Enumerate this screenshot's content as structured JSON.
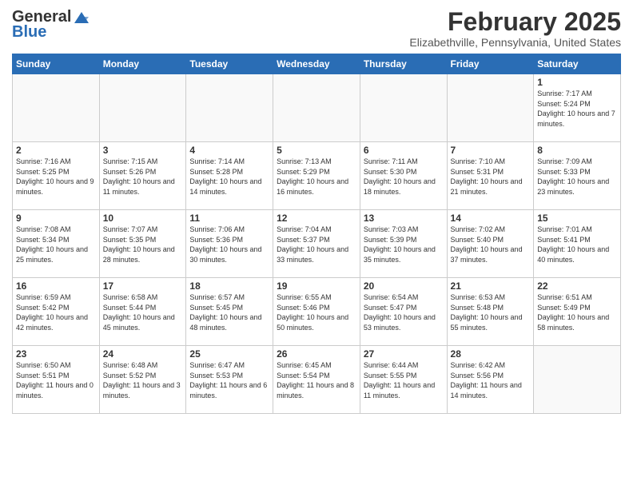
{
  "header": {
    "logo_general": "General",
    "logo_blue": "Blue",
    "month_title": "February 2025",
    "location": "Elizabethville, Pennsylvania, United States"
  },
  "weekdays": [
    "Sunday",
    "Monday",
    "Tuesday",
    "Wednesday",
    "Thursday",
    "Friday",
    "Saturday"
  ],
  "weeks": [
    [
      {
        "day": "",
        "info": ""
      },
      {
        "day": "",
        "info": ""
      },
      {
        "day": "",
        "info": ""
      },
      {
        "day": "",
        "info": ""
      },
      {
        "day": "",
        "info": ""
      },
      {
        "day": "",
        "info": ""
      },
      {
        "day": "1",
        "info": "Sunrise: 7:17 AM\nSunset: 5:24 PM\nDaylight: 10 hours and 7 minutes."
      }
    ],
    [
      {
        "day": "2",
        "info": "Sunrise: 7:16 AM\nSunset: 5:25 PM\nDaylight: 10 hours and 9 minutes."
      },
      {
        "day": "3",
        "info": "Sunrise: 7:15 AM\nSunset: 5:26 PM\nDaylight: 10 hours and 11 minutes."
      },
      {
        "day": "4",
        "info": "Sunrise: 7:14 AM\nSunset: 5:28 PM\nDaylight: 10 hours and 14 minutes."
      },
      {
        "day": "5",
        "info": "Sunrise: 7:13 AM\nSunset: 5:29 PM\nDaylight: 10 hours and 16 minutes."
      },
      {
        "day": "6",
        "info": "Sunrise: 7:11 AM\nSunset: 5:30 PM\nDaylight: 10 hours and 18 minutes."
      },
      {
        "day": "7",
        "info": "Sunrise: 7:10 AM\nSunset: 5:31 PM\nDaylight: 10 hours and 21 minutes."
      },
      {
        "day": "8",
        "info": "Sunrise: 7:09 AM\nSunset: 5:33 PM\nDaylight: 10 hours and 23 minutes."
      }
    ],
    [
      {
        "day": "9",
        "info": "Sunrise: 7:08 AM\nSunset: 5:34 PM\nDaylight: 10 hours and 25 minutes."
      },
      {
        "day": "10",
        "info": "Sunrise: 7:07 AM\nSunset: 5:35 PM\nDaylight: 10 hours and 28 minutes."
      },
      {
        "day": "11",
        "info": "Sunrise: 7:06 AM\nSunset: 5:36 PM\nDaylight: 10 hours and 30 minutes."
      },
      {
        "day": "12",
        "info": "Sunrise: 7:04 AM\nSunset: 5:37 PM\nDaylight: 10 hours and 33 minutes."
      },
      {
        "day": "13",
        "info": "Sunrise: 7:03 AM\nSunset: 5:39 PM\nDaylight: 10 hours and 35 minutes."
      },
      {
        "day": "14",
        "info": "Sunrise: 7:02 AM\nSunset: 5:40 PM\nDaylight: 10 hours and 37 minutes."
      },
      {
        "day": "15",
        "info": "Sunrise: 7:01 AM\nSunset: 5:41 PM\nDaylight: 10 hours and 40 minutes."
      }
    ],
    [
      {
        "day": "16",
        "info": "Sunrise: 6:59 AM\nSunset: 5:42 PM\nDaylight: 10 hours and 42 minutes."
      },
      {
        "day": "17",
        "info": "Sunrise: 6:58 AM\nSunset: 5:44 PM\nDaylight: 10 hours and 45 minutes."
      },
      {
        "day": "18",
        "info": "Sunrise: 6:57 AM\nSunset: 5:45 PM\nDaylight: 10 hours and 48 minutes."
      },
      {
        "day": "19",
        "info": "Sunrise: 6:55 AM\nSunset: 5:46 PM\nDaylight: 10 hours and 50 minutes."
      },
      {
        "day": "20",
        "info": "Sunrise: 6:54 AM\nSunset: 5:47 PM\nDaylight: 10 hours and 53 minutes."
      },
      {
        "day": "21",
        "info": "Sunrise: 6:53 AM\nSunset: 5:48 PM\nDaylight: 10 hours and 55 minutes."
      },
      {
        "day": "22",
        "info": "Sunrise: 6:51 AM\nSunset: 5:49 PM\nDaylight: 10 hours and 58 minutes."
      }
    ],
    [
      {
        "day": "23",
        "info": "Sunrise: 6:50 AM\nSunset: 5:51 PM\nDaylight: 11 hours and 0 minutes."
      },
      {
        "day": "24",
        "info": "Sunrise: 6:48 AM\nSunset: 5:52 PM\nDaylight: 11 hours and 3 minutes."
      },
      {
        "day": "25",
        "info": "Sunrise: 6:47 AM\nSunset: 5:53 PM\nDaylight: 11 hours and 6 minutes."
      },
      {
        "day": "26",
        "info": "Sunrise: 6:45 AM\nSunset: 5:54 PM\nDaylight: 11 hours and 8 minutes."
      },
      {
        "day": "27",
        "info": "Sunrise: 6:44 AM\nSunset: 5:55 PM\nDaylight: 11 hours and 11 minutes."
      },
      {
        "day": "28",
        "info": "Sunrise: 6:42 AM\nSunset: 5:56 PM\nDaylight: 11 hours and 14 minutes."
      },
      {
        "day": "",
        "info": ""
      }
    ]
  ]
}
